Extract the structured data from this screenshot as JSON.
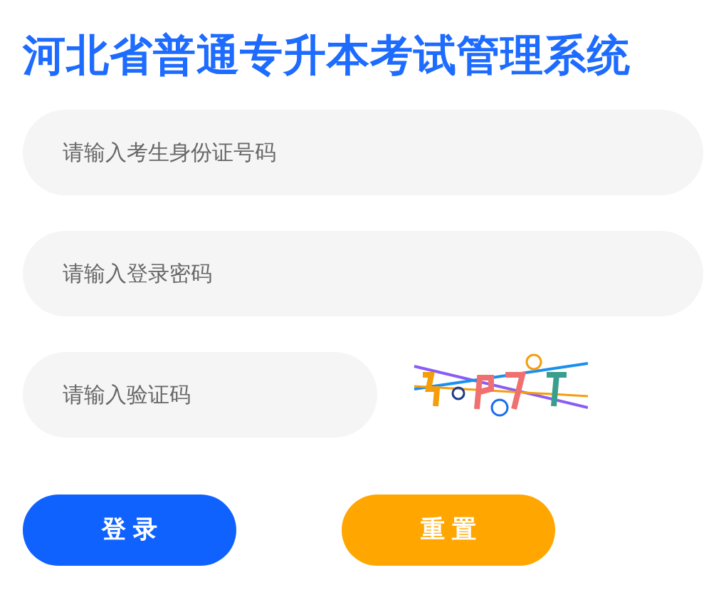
{
  "title": "河北省普通专升本考试管理系统",
  "fields": [
    {
      "placeholder": "请输入考生身份证号码"
    },
    {
      "placeholder": "请输入登录密码"
    },
    {
      "placeholder": "请输入验证码",
      "kind": "captcha"
    }
  ],
  "buttons": [
    {
      "label": "登 录",
      "kind": "primary"
    },
    {
      "label": "重 置",
      "kind": "secondary"
    }
  ]
}
